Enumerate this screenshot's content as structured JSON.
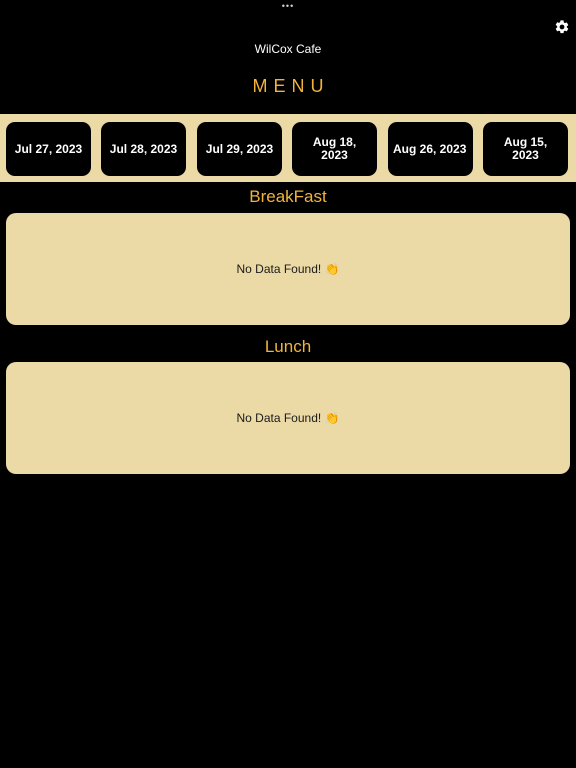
{
  "status_bar": {
    "dots": "•••"
  },
  "header": {
    "settings_icon": "gear-icon",
    "app_title": "WilCox Cafe",
    "menu_heading": "MENU"
  },
  "dates": [
    {
      "label": "Jul 27, 2023"
    },
    {
      "label": "Jul 28, 2023"
    },
    {
      "label": "Jul 29, 2023"
    },
    {
      "label": "Aug 18, 2023"
    },
    {
      "label": "Aug 26, 2023"
    },
    {
      "label": "Aug 15, 2023"
    }
  ],
  "sections": {
    "breakfast": {
      "title": "BreakFast",
      "empty_text": "No Data Found! 👏"
    },
    "lunch": {
      "title": "Lunch",
      "empty_text": "No Data Found! 👏"
    }
  },
  "colors": {
    "background": "#000000",
    "accent": "#f2b33d",
    "card": "#ebd9a6"
  }
}
